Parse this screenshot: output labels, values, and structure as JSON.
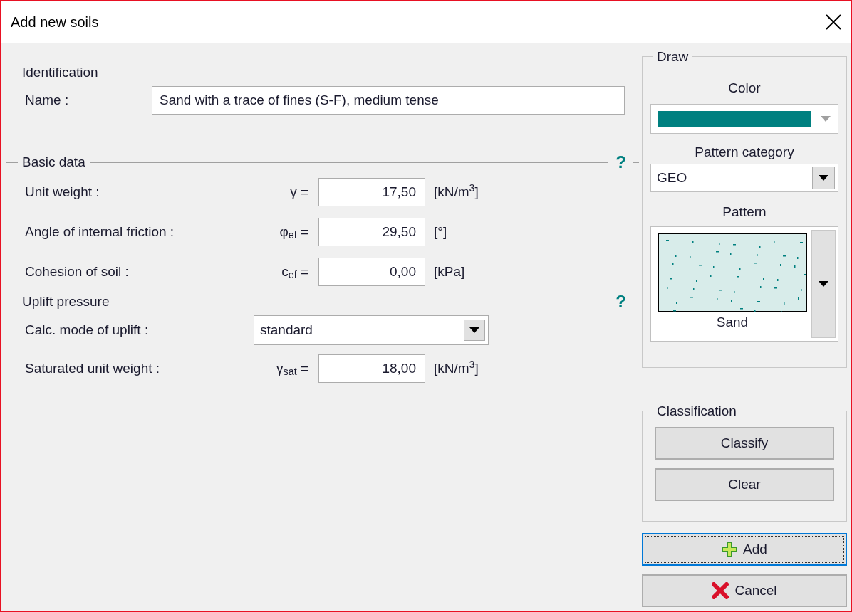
{
  "window": {
    "title": "Add new soils"
  },
  "identification": {
    "title": "Identification",
    "name_label": "Name :",
    "name_value": "Sand with a trace of fines (S-F), medium tense"
  },
  "basic_data": {
    "title": "Basic data",
    "help": "?",
    "fields": [
      {
        "label": "Unit weight :",
        "symbol": "γ =",
        "value": "17,50",
        "unit": "[kN/m$^{3}$]"
      },
      {
        "label": "Angle of internal friction :",
        "symbol": "φ$_{ef}$ =",
        "value": "29,50",
        "unit": "[°]"
      },
      {
        "label": "Cohesion of soil :",
        "symbol": "c$_{ef}$ =",
        "value": "0,00",
        "unit": "[kPa]"
      }
    ]
  },
  "uplift": {
    "title": "Uplift pressure",
    "help": "?",
    "mode_label": "Calc. mode of uplift :",
    "mode_value": "standard",
    "fields": [
      {
        "label": "Saturated unit weight :",
        "symbol": "γ$_{sat}$ =",
        "value": "18,00",
        "unit": "[kN/m$^{3}$]"
      }
    ]
  },
  "draw": {
    "title": "Draw",
    "color_label": "Color",
    "color": "#008080",
    "category_label": "Pattern category",
    "category": "GEO",
    "pattern_label": "Pattern",
    "pattern": "Sand"
  },
  "classification": {
    "title": "Classification",
    "buttons": [
      "Classify",
      "Clear"
    ]
  },
  "buttons": [
    {
      "label": "Add",
      "kind": "add",
      "focused": true
    },
    {
      "label": "Cancel",
      "kind": "cancel",
      "focused": false
    }
  ]
}
